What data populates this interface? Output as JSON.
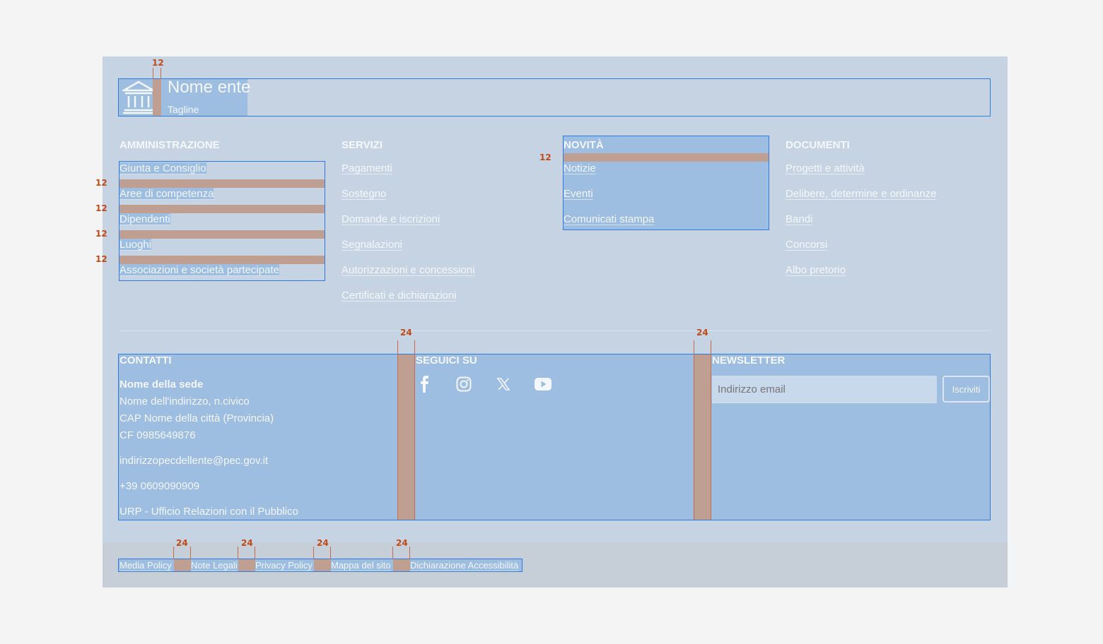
{
  "brand": {
    "name": "Nome ente",
    "tagline": "Tagline",
    "logo_icon": "government-building-icon"
  },
  "columns": {
    "amministrazione": {
      "title": "AMMINISTRAZIONE",
      "items": [
        "Giunta e Consiglio",
        "Aree di competenza",
        "Dipendenti",
        "Luoghi",
        "Associazioni e società partecipate"
      ]
    },
    "servizi": {
      "title": "SERVIZI",
      "items": [
        "Pagamenti",
        "Sostegno",
        "Domande e iscrizioni",
        "Segnalazioni",
        "Autorizzazioni e concessioni",
        "Certificati e dichiarazioni"
      ]
    },
    "novita": {
      "title": "NOVITÀ",
      "items": [
        "Notizie",
        "Eventi",
        "Comunicati stampa"
      ]
    },
    "documenti": {
      "title": "DOCUMENTI",
      "items": [
        "Progetti e attività",
        "Delibere, determine e ordinanze",
        "Bandi",
        "Concorsi",
        "Albo pretorio"
      ]
    }
  },
  "contatti": {
    "title": "CONTATTI",
    "sede": "Nome della sede",
    "indirizzo": "Nome dell'indirizzo, n.civico",
    "citta": "CAP Nome della città (Provincia)",
    "cf": "CF 0985649876",
    "pec": "indirizzopecdellente@pec.gov.it",
    "telefono": "+39 0609090909",
    "urp": "URP - Ufficio Relazioni con il Pubblico"
  },
  "social": {
    "title": "SEGUICI SU",
    "icons": [
      "facebook-icon",
      "instagram-icon",
      "x-twitter-icon",
      "youtube-icon"
    ]
  },
  "newsletter": {
    "title": "NEWSLETTER",
    "placeholder": "Indirizzo email",
    "button": "Iscriviti"
  },
  "legal_links": [
    "Media Policy",
    "Note Legali",
    "Privacy Policy",
    "Mappa del sito",
    "Dichiarazione Accessibilità"
  ],
  "spacing_annotations": {
    "logo_gap": "12",
    "list_gap": "12",
    "novita_gap": "12",
    "column_gap_1": "24",
    "column_gap_2": "24",
    "legal_gaps": [
      "24",
      "24",
      "24",
      "24"
    ]
  },
  "colors": {
    "frame": "#c5d3e3",
    "selection_fill": "#9dbde1",
    "selection_border": "#2f7be5",
    "spacing_gap": "#c09f93",
    "spacing_label": "#c24a16"
  }
}
